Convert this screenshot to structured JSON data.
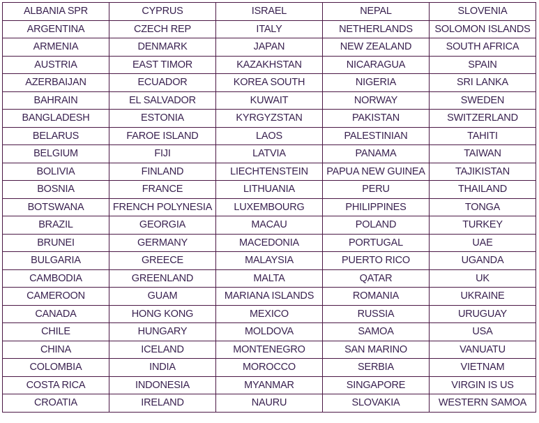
{
  "table": {
    "border_color": "#4b1845",
    "text_color": "#3a2250",
    "rows": [
      [
        "ALBANIA SPR",
        "CYPRUS",
        "ISRAEL",
        "NEPAL",
        "SLOVENIA"
      ],
      [
        "ARGENTINA",
        "CZECH REP",
        "ITALY",
        "NETHERLANDS",
        "SOLOMON ISLANDS"
      ],
      [
        "ARMENIA",
        "DENMARK",
        "JAPAN",
        "NEW ZEALAND",
        "SOUTH AFRICA"
      ],
      [
        "AUSTRIA",
        "EAST TIMOR",
        "KAZAKHSTAN",
        "NICARAGUA",
        "SPAIN"
      ],
      [
        "AZERBAIJAN",
        "ECUADOR",
        "KOREA SOUTH",
        "NIGERIA",
        "SRI LANKA"
      ],
      [
        "BAHRAIN",
        "EL SALVADOR",
        "KUWAIT",
        "NORWAY",
        "SWEDEN"
      ],
      [
        "BANGLADESH",
        "ESTONIA",
        "KYRGYZSTAN",
        "PAKISTAN",
        "SWITZERLAND"
      ],
      [
        "BELARUS",
        "FAROE ISLAND",
        "LAOS",
        "PALESTINIAN",
        "TAHITI"
      ],
      [
        "BELGIUM",
        "FIJI",
        "LATVIA",
        "PANAMA",
        "TAIWAN"
      ],
      [
        "BOLIVIA",
        "FINLAND",
        "LIECHTENSTEIN",
        "PAPUA NEW GUINEA",
        "TAJIKISTAN"
      ],
      [
        "BOSNIA",
        "FRANCE",
        "LITHUANIA",
        "PERU",
        "THAILAND"
      ],
      [
        "BOTSWANA",
        "FRENCH POLYNESIA",
        "LUXEMBOURG",
        "PHILIPPINES",
        "TONGA"
      ],
      [
        "BRAZIL",
        "GEORGIA",
        "MACAU",
        "POLAND",
        "TURKEY"
      ],
      [
        "BRUNEI",
        "GERMANY",
        "MACEDONIA",
        "PORTUGAL",
        "UAE"
      ],
      [
        "BULGARIA",
        "GREECE",
        "MALAYSIA",
        "PUERTO RICO",
        "UGANDA"
      ],
      [
        "CAMBODIA",
        "GREENLAND",
        "MALTA",
        "QATAR",
        "UK"
      ],
      [
        "CAMEROON",
        "GUAM",
        "MARIANA ISLANDS",
        "ROMANIA",
        "UKRAINE"
      ],
      [
        "CANADA",
        "HONG KONG",
        "MEXICO",
        "RUSSIA",
        "URUGUAY"
      ],
      [
        "CHILE",
        "HUNGARY",
        "MOLDOVA",
        "SAMOA",
        "USA"
      ],
      [
        "CHINA",
        "ICELAND",
        "MONTENEGRO",
        "SAN MARINO",
        "VANUATU"
      ],
      [
        "COLOMBIA",
        "INDIA",
        "MOROCCO",
        "SERBIA",
        "VIETNAM"
      ],
      [
        "COSTA RICA",
        "INDONESIA",
        "MYANMAR",
        "SINGAPORE",
        "VIRGIN IS US"
      ],
      [
        "CROATIA",
        "IRELAND",
        "NAURU",
        "SLOVAKIA",
        "WESTERN SAMOA"
      ]
    ]
  }
}
